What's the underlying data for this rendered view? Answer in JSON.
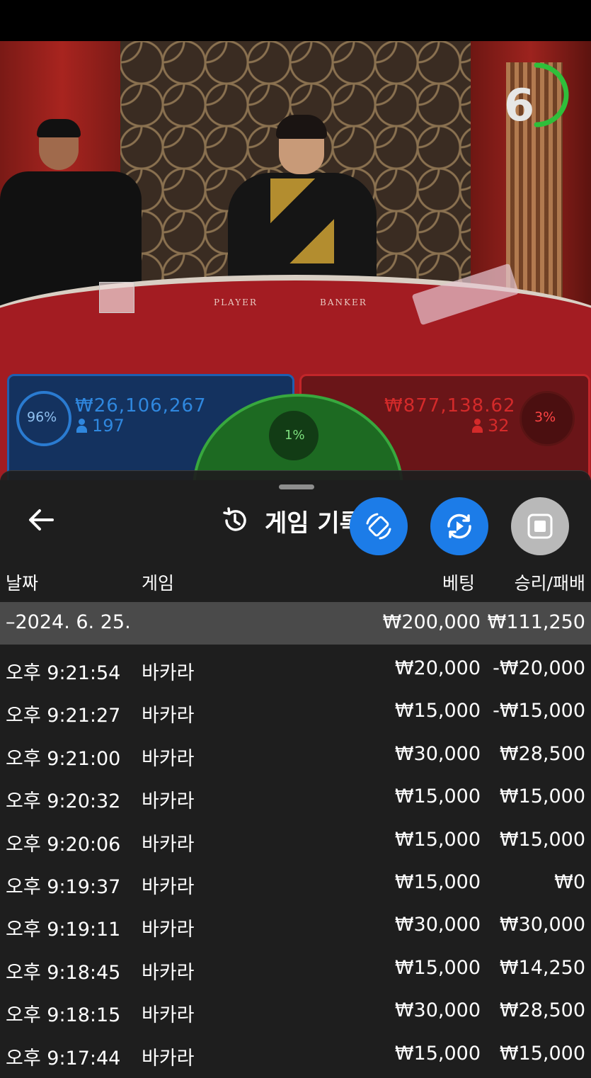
{
  "video": {
    "table_labels": {
      "player": "PLAYER",
      "banker": "BANKER"
    },
    "countdown": "6",
    "countdown_color": "#2fbf3a",
    "player": {
      "percent": "96%",
      "amount": "₩26,106,267",
      "count": "197",
      "color": "#2f87de"
    },
    "banker": {
      "percent": "3%",
      "amount": "₩877,138.62",
      "count": "32",
      "color": "#d42a2a"
    },
    "tie": {
      "percent": "1%",
      "color": "#38a83e"
    }
  },
  "sheet": {
    "title": "게임 기록",
    "back_icon": "arrow-left-icon",
    "history_icon": "history-icon",
    "fab_buttons": [
      {
        "icon": "rotate-device-icon",
        "color": "#1c7ce8"
      },
      {
        "icon": "replay-video-icon",
        "color": "#1c7ce8"
      },
      {
        "icon": "stop-square-icon",
        "color": "#b9b9b9"
      }
    ],
    "columns": {
      "date": "날짜",
      "game": "게임",
      "bet": "베팅",
      "result": "승리/패배"
    },
    "date_group": {
      "label": "–2024. 6. 25.",
      "bet": "₩200,000",
      "result": "₩111,250"
    },
    "rows": [
      {
        "time": "오후 9:21:54",
        "game": "바카라",
        "bet": "₩20,000",
        "result": "-₩20,000"
      },
      {
        "time": "오후 9:21:27",
        "game": "바카라",
        "bet": "₩15,000",
        "result": "-₩15,000"
      },
      {
        "time": "오후 9:21:00",
        "game": "바카라",
        "bet": "₩30,000",
        "result": "₩28,500"
      },
      {
        "time": "오후 9:20:32",
        "game": "바카라",
        "bet": "₩15,000",
        "result": "₩15,000"
      },
      {
        "time": "오후 9:20:06",
        "game": "바카라",
        "bet": "₩15,000",
        "result": "₩15,000"
      },
      {
        "time": "오후 9:19:37",
        "game": "바카라",
        "bet": "₩15,000",
        "result": "₩0"
      },
      {
        "time": "오후 9:19:11",
        "game": "바카라",
        "bet": "₩30,000",
        "result": "₩30,000"
      },
      {
        "time": "오후 9:18:45",
        "game": "바카라",
        "bet": "₩15,000",
        "result": "₩14,250"
      },
      {
        "time": "오후 9:18:15",
        "game": "바카라",
        "bet": "₩30,000",
        "result": "₩28,500"
      },
      {
        "time": "오후 9:17:44",
        "game": "바카라",
        "bet": "₩15,000",
        "result": "₩15,000"
      }
    ]
  }
}
